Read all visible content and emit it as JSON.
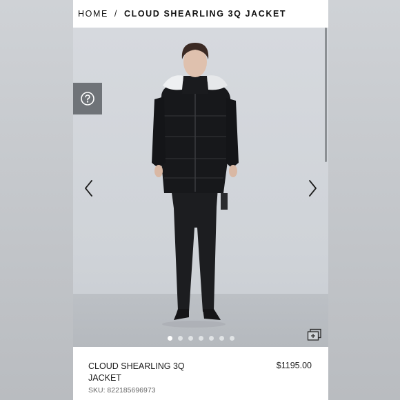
{
  "breadcrumb": {
    "home": "HOME",
    "separator": "/",
    "current": "CLOUD SHEARLING 3Q JACKET"
  },
  "gallery": {
    "help_icon": "question-circle-icon",
    "prev_icon": "chevron-left-icon",
    "next_icon": "chevron-right-icon",
    "zoom_icon": "gallery-expand-icon",
    "slide_count": 7,
    "active_slide": 1
  },
  "product": {
    "name": "CLOUD SHEARLING 3Q JACKET",
    "price": "$1195.00",
    "sku": "SKU: 822185696973"
  },
  "colors": {
    "help_button_bg": "#6f7378",
    "photo_bg": "#d3d6db",
    "text": "#1b1b1b"
  }
}
